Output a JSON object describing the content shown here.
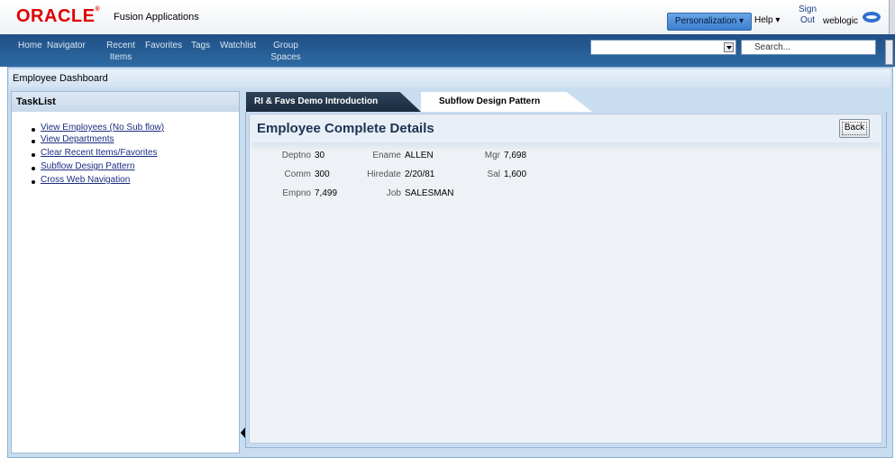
{
  "brand": {
    "logo_text": "ORACLE",
    "logo_tm": "®",
    "product": "Fusion Applications"
  },
  "header_actions": {
    "personalization": "Personalization ▾",
    "help": "Help ▾",
    "sign_out": "Sign Out",
    "user": "weblogic",
    "icon": "oracle-o-icon"
  },
  "navbar": {
    "items": [
      {
        "label": "Home"
      },
      {
        "label": "Navigator"
      },
      {
        "label": "Recent Items"
      },
      {
        "label": "Favorites"
      },
      {
        "label": "Tags"
      },
      {
        "label": "Watchlist"
      },
      {
        "label": "Group Spaces"
      }
    ],
    "search_select_value": "",
    "search_placeholder": "Search..."
  },
  "page": {
    "header": "Employee Dashboard"
  },
  "tasklist": {
    "title": "TaskList",
    "items": [
      {
        "label": "View Employees (No Sub flow)"
      },
      {
        "label": "View Departments"
      },
      {
        "label": "Clear Recent Items/Favorites"
      },
      {
        "label": "Subflow Design Pattern"
      },
      {
        "label": "Cross Web Navigation"
      }
    ]
  },
  "tabs": [
    {
      "label": "RI & Favs Demo Introduction",
      "selected": false
    },
    {
      "label": "Subflow Design Pattern",
      "selected": true
    }
  ],
  "details": {
    "title": "Employee Complete Details",
    "back_label": "Back",
    "fields": {
      "deptno": {
        "label": "Deptno",
        "value": "30"
      },
      "ename": {
        "label": "Ename",
        "value": "ALLEN"
      },
      "mgr": {
        "label": "Mgr",
        "value": "7,698"
      },
      "comm": {
        "label": "Comm",
        "value": "300"
      },
      "hiredate": {
        "label": "Hiredate",
        "value": "2/20/81"
      },
      "sal": {
        "label": "Sal",
        "value": "1,600"
      },
      "empno": {
        "label": "Empno",
        "value": "7,499"
      },
      "job": {
        "label": "Job",
        "value": "SALESMAN"
      }
    }
  },
  "colors": {
    "navbar": "#2e6aa3",
    "accent": "#3d7fcf",
    "logo": "#e00000",
    "tab_dark": "#1b2c3f"
  }
}
